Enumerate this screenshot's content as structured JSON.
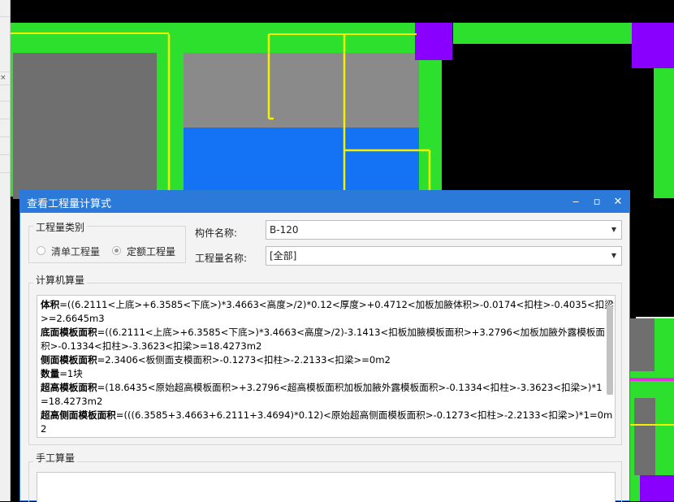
{
  "dialog": {
    "title": "查看工程量计算式",
    "minimize_icon": "minimize-icon",
    "maximize_icon": "maximize-icon",
    "close_icon": "close-icon",
    "category_group": {
      "label": "工程量类别",
      "option_list": "清单工程量",
      "option_quota": "定额工程量",
      "selected": "定额工程量"
    },
    "component_name_label": "构件名称:",
    "component_name_value": "B-120",
    "quantity_name_label": "工程量名称:",
    "quantity_name_value": "[全部]",
    "computer_section_label": "计算机算量",
    "computer_lines": [
      {
        "key": "体积",
        "text": "=((6.2111<上底>+6.3585<下底>)*3.4663<高度>/2)*0.12<厚度>+0.4712<加板加腋体积>-0.0174<扣柱>-0.4035<扣梁"
      },
      {
        "key": "",
        "text": ">=2.6645m3"
      },
      {
        "key": "底面模板面积",
        "text": "=((6.2111<上底>+6.3585<下底>)*3.4663<高度>/2)-3.1413<扣板加腋模板面积>+3.2796<加板加腋外露模板面"
      },
      {
        "key": "",
        "text": "积>-0.1334<扣柱>-3.3623<扣梁>=18.4273m2"
      },
      {
        "key": "侧面模板面积",
        "text": "=2.3406<板侧面支模面积>-0.1273<扣柱>-2.2133<扣梁>=0m2"
      },
      {
        "key": "数量",
        "text": "=1块"
      },
      {
        "key": "超高模板面积",
        "text": "=(18.6435<原始超高模板面积>+3.2796<超高模板面积加板加腋外露模板面积>-0.1334<扣柱>-3.3623<扣梁>)*1"
      },
      {
        "key": "",
        "text": "=18.4273m2"
      },
      {
        "key": "超高侧面模板面积",
        "text": "=(((6.3585+3.4663+6.2111+3.4694)*0.12)<原始超高侧面模板面积>-0.1273<扣柱>-2.2133<扣梁>)*1=0m"
      },
      {
        "key": "",
        "text": "2"
      }
    ],
    "manual_section_label": "手工算量"
  },
  "colors": {
    "title_bar": "#2b79d9",
    "cad_green": "#2ee02e",
    "cad_yellow": "#f2f200",
    "cad_purple": "#8a00ff",
    "cad_blue": "#1473f5",
    "cad_gray": "#8a8a8a"
  }
}
